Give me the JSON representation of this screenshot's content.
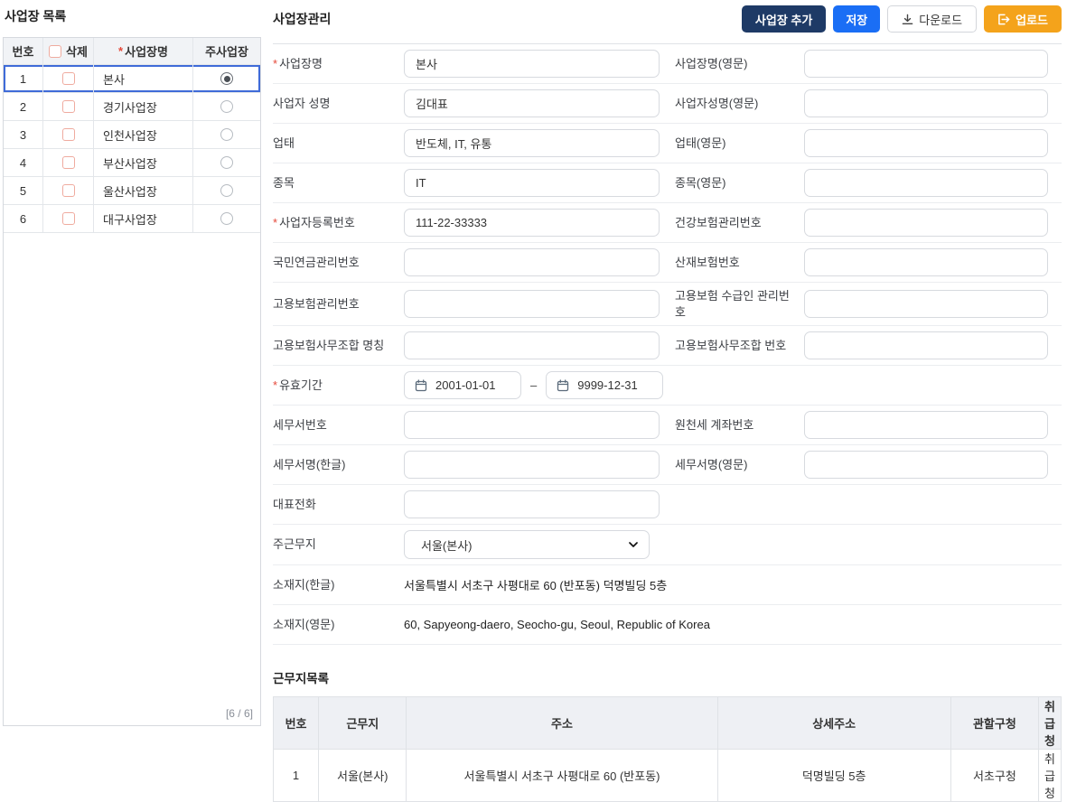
{
  "left_panel": {
    "title": "사업장 목록",
    "headers": {
      "no": "번호",
      "delete": "삭제",
      "name_req": "*",
      "name": "사업장명",
      "main_site": "주사업장"
    },
    "rows": [
      {
        "no": "1",
        "name": "본사"
      },
      {
        "no": "2",
        "name": "경기사업장"
      },
      {
        "no": "3",
        "name": "인천사업장"
      },
      {
        "no": "4",
        "name": "부산사업장"
      },
      {
        "no": "5",
        "name": "울산사업장"
      },
      {
        "no": "6",
        "name": "대구사업장"
      }
    ],
    "pager": "[6 / 6]"
  },
  "toolbar": {
    "title": "사업장관리",
    "add_label": "사업장 추가",
    "save_label": "저장",
    "download_label": "다운로드",
    "upload_label": "업로드"
  },
  "form": {
    "site_name": {
      "req": "*",
      "label": "사업장명",
      "value": "본사"
    },
    "site_name_en": {
      "label": "사업장명(영문)",
      "value": ""
    },
    "owner_name": {
      "label": "사업자 성명",
      "value": "김대표"
    },
    "owner_name_en": {
      "label": "사업자성명(영문)",
      "value": ""
    },
    "biz_type": {
      "label": "업태",
      "value": "반도체, IT, 유통"
    },
    "biz_type_en": {
      "label": "업태(영문)",
      "value": ""
    },
    "biz_item": {
      "label": "종목",
      "value": "IT"
    },
    "biz_item_en": {
      "label": "종목(영문)",
      "value": ""
    },
    "biz_reg_no": {
      "req": "*",
      "label": "사업자등록번호",
      "value": "111-22-33333"
    },
    "health_ins_no": {
      "label": "건강보험관리번호",
      "value": ""
    },
    "pension_no": {
      "label": "국민연금관리번호",
      "value": ""
    },
    "accident_ins_no": {
      "label": "산재보험번호",
      "value": ""
    },
    "employ_ins_no": {
      "label": "고용보험관리번호",
      "value": ""
    },
    "employ_ins_recipient_no": {
      "label": "고용보험 수급인 관리번호",
      "value": ""
    },
    "employ_ins_office_name": {
      "label": "고용보험사무조합 명칭",
      "value": ""
    },
    "employ_ins_office_no": {
      "label": "고용보험사무조합 번호",
      "value": ""
    },
    "valid_period": {
      "req": "*",
      "label": "유효기간",
      "start": "2001-01-01",
      "separator": "–",
      "end": "9999-12-31"
    },
    "tax_office_no": {
      "label": "세무서번호",
      "value": ""
    },
    "withholding_account": {
      "label": "원천세 계좌번호",
      "value": ""
    },
    "tax_office_name_kr": {
      "label": "세무서명(한글)",
      "value": ""
    },
    "tax_office_name_en": {
      "label": "세무서명(영문)",
      "value": ""
    },
    "main_phone": {
      "label": "대표전화",
      "value": ""
    },
    "main_workplace": {
      "label": "주근무지",
      "value": "서울(본사)"
    },
    "address_kr": {
      "label": "소재지(한글)",
      "value": "서울특별시 서초구 사평대로 60 (반포동) 덕명빌딩 5층"
    },
    "address_en": {
      "label": "소재지(영문)",
      "value": "60, Sapyeong-daero, Seocho-gu, Seoul, Republic of Korea"
    }
  },
  "workplace_list": {
    "title": "근무지목록",
    "headers": [
      "번호",
      "근무지",
      "주소",
      "상세주소",
      "관할구청",
      "취급청"
    ],
    "rows": [
      {
        "no": "1",
        "name": "서울(본사)",
        "address": "서울특별시 서초구 사평대로 60 (반포동)",
        "detail": "덕명빌딩 5층",
        "district": "서초구청",
        "agency": "취급청"
      }
    ]
  }
}
